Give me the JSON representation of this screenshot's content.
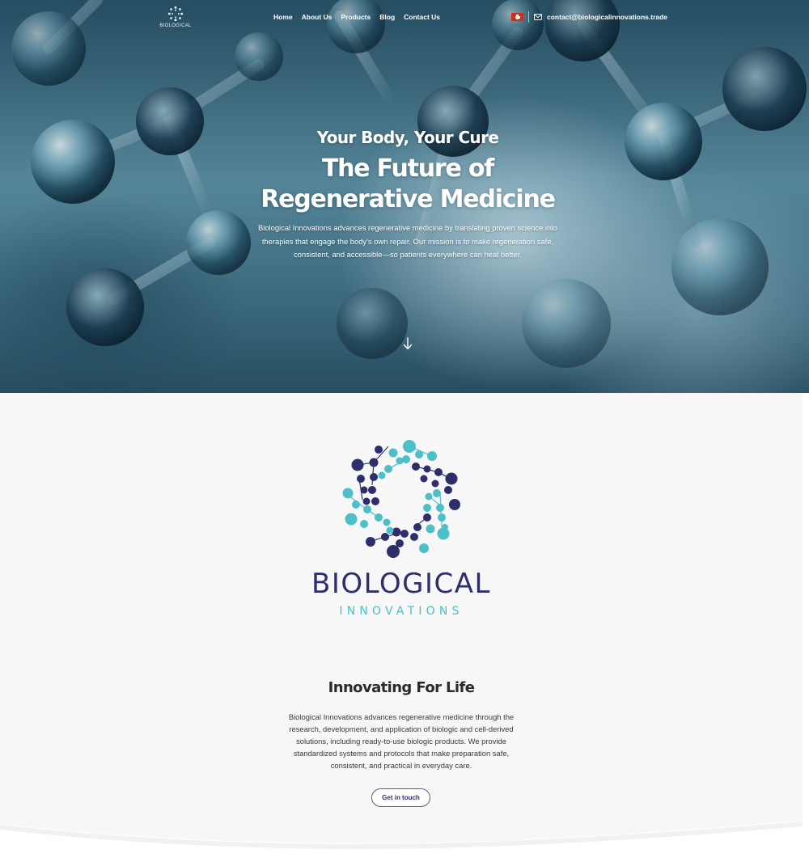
{
  "header": {
    "logo": {
      "icon": "molecule-ring-logo-icon",
      "text": "BIOLOGICAL"
    },
    "nav": [
      {
        "label": "Home"
      },
      {
        "label": "About Us"
      },
      {
        "label": "Products"
      },
      {
        "label": "Blog"
      },
      {
        "label": "Contact Us"
      }
    ],
    "flag_icon": "swiss-flag-icon",
    "email_icon": "envelope-icon",
    "email": "contact@biologicalinnovations.trade"
  },
  "hero": {
    "kicker": "Your Body, Your Cure",
    "title_line1": "The Future of",
    "title_line2": "Regenerative Medicine",
    "description": "Biological Innovations advances regenerative medicine by translating proven science into therapies that engage the body's own repair. Our mission is to make regeneration safe, consistent, and accessible—so patients everywhere can heal better.",
    "scroll_icon": "arrow-down-icon"
  },
  "brand": {
    "logo_icon": "molecule-ring-logo-icon",
    "name": "BIOLOGICAL",
    "subtitle": "INNOVATIONS",
    "colors": {
      "navy": "#2c2f6b",
      "teal": "#4cbfc8"
    }
  },
  "about": {
    "title": "Innovating For Life",
    "description": "Biological Innovations advances regenerative medicine through the research, development, and application of biologic and cell-derived solutions, including ready-to-use biologic products. We provide standardized systems and protocols that make preparation safe, consistent, and practical in everyday care.",
    "cta_label": "Get in touch"
  }
}
